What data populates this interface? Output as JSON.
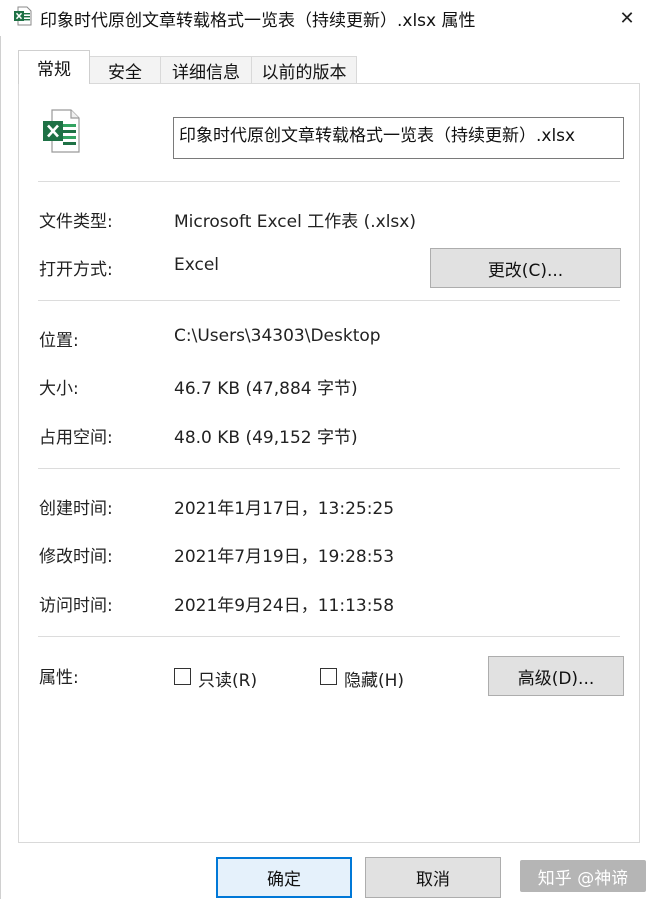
{
  "window": {
    "title": "印象时代原创文章转载格式一览表（持续更新）.xlsx 属性",
    "close_glyph": "✕"
  },
  "tabs": [
    {
      "label": "常规",
      "active": true
    },
    {
      "label": "安全",
      "active": false
    },
    {
      "label": "详细信息",
      "active": false
    },
    {
      "label": "以前的版本",
      "active": false
    }
  ],
  "file": {
    "name": "印象时代原创文章转载格式一览表（持续更新）.xlsx",
    "icon": "excel-file-icon"
  },
  "general": {
    "type_label": "文件类型:",
    "type_value": "Microsoft Excel 工作表 (.xlsx)",
    "opens_with_label": "打开方式:",
    "opens_with_value": "Excel",
    "change_button": "更改(C)..."
  },
  "location": {
    "location_label": "位置:",
    "location_value": "C:\\Users\\34303\\Desktop",
    "size_label": "大小:",
    "size_value": "46.7 KB (47,884 字节)",
    "disk_label": "占用空间:",
    "disk_value": "48.0 KB (49,152 字节)"
  },
  "times": {
    "created_label": "创建时间:",
    "created_value": "2021年1月17日，13:25:25",
    "modified_label": "修改时间:",
    "modified_value": "2021年7月19日，19:28:53",
    "accessed_label": "访问时间:",
    "accessed_value": "2021年9月24日，11:13:58"
  },
  "attributes": {
    "label": "属性:",
    "readonly_label": "只读(R)",
    "readonly_checked": false,
    "hidden_label": "隐藏(H)",
    "hidden_checked": false,
    "advanced_button": "高级(D)..."
  },
  "footer": {
    "ok_button": "确定",
    "cancel_button": "取消"
  },
  "watermark": "知乎 @神谛",
  "colors": {
    "excel_green": "#1e7145",
    "accent_blue": "#0078d7"
  }
}
